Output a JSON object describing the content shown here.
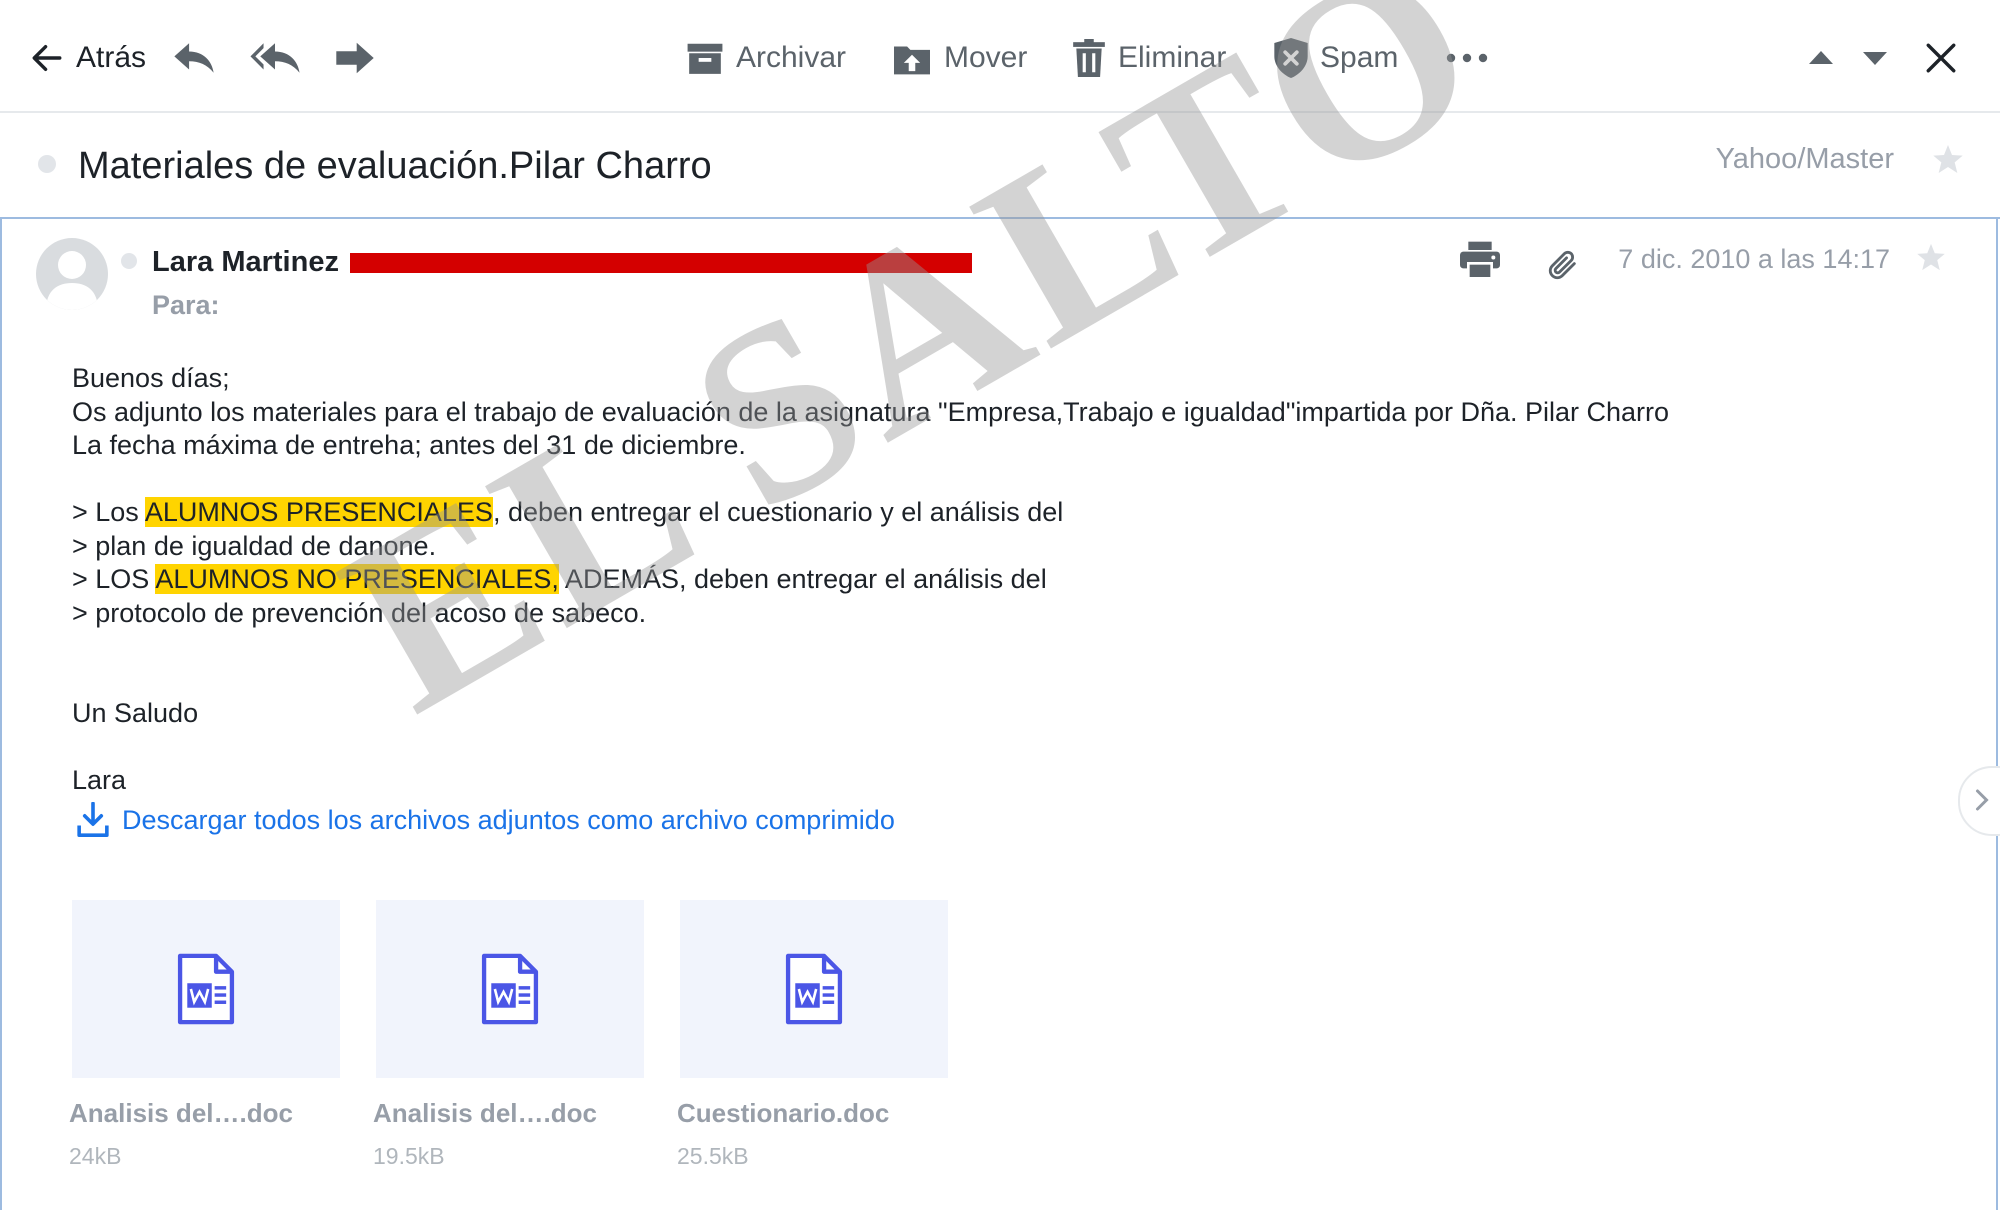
{
  "toolbar": {
    "back_label": "Atrás",
    "archive_label": "Archivar",
    "move_label": "Mover",
    "delete_label": "Eliminar",
    "spam_label": "Spam"
  },
  "message": {
    "subject": "Materiales de evaluación.Pilar Charro",
    "folder": "Yahoo/Master",
    "sender_name": "Lara Martinez",
    "to_label": "Para:",
    "date": "7 dic. 2010 a las 14:17",
    "body": {
      "greeting": "Buenos días;",
      "line1": "Os adjunto los materiales para el trabajo de evaluación de la asignatura \"Empresa,Trabajo e igualdad\"impartida por Dña. Pilar Charro",
      "line2": "La fecha máxima de entreha; antes del 31 de diciembre.",
      "q1_pre": "> Los ",
      "q1_hl": "ALUMNOS PRESENCIALES",
      "q1_post": ", deben entregar el cuestionario y el análisis del",
      "q2": "> plan de igualdad de danone.",
      "q3_pre": "> LOS ",
      "q3_hl": "ALUMNOS NO PRESENCIALES,",
      "q3_post": " ADEMÁS, deben entregar el análisis del",
      "q4": "> protocolo de prevención del acoso de sabeco.",
      "closing": "Un Saludo",
      "signature": "Lara"
    },
    "download_all_label": "Descargar todos los archivos adjuntos como archivo comprimido",
    "attachments": [
      {
        "name": "Analisis del….doc",
        "size": "24kB"
      },
      {
        "name": "Analisis del….doc",
        "size": "19.5kB"
      },
      {
        "name": "Cuestionario.doc",
        "size": "25.5kB"
      }
    ]
  },
  "watermark": "EL SALTO",
  "colors": {
    "link": "#1a73e8",
    "highlight": "#ffd400",
    "word_icon": "#4b56e6",
    "redaction": "#d40000"
  }
}
